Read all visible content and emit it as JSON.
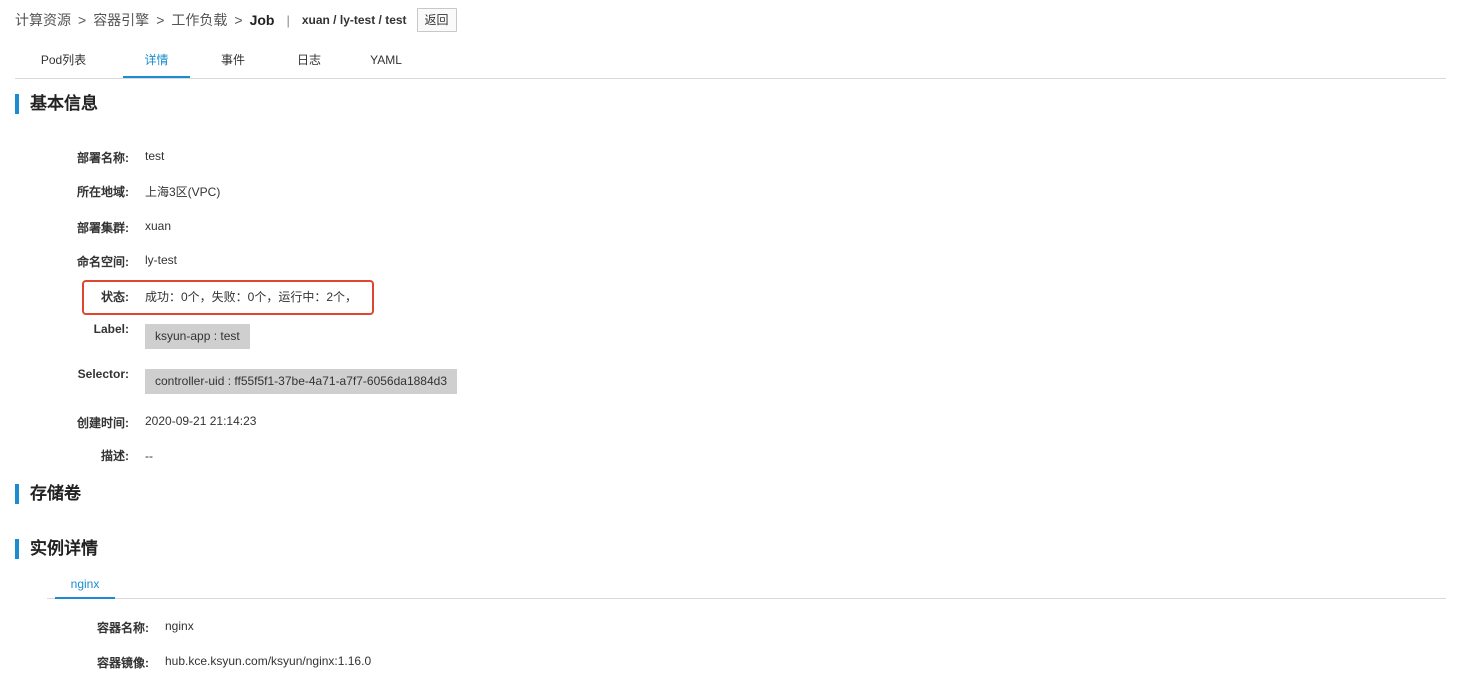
{
  "breadcrumb": {
    "items": [
      "计算资源",
      "容器引擎",
      "工作负载"
    ],
    "separator": ">",
    "current": "Job",
    "divider": "|",
    "path": "xuan / ly-test / test",
    "back_label": "返回"
  },
  "tabs": [
    {
      "label": "Pod列表",
      "active": false
    },
    {
      "label": "详情",
      "active": true
    },
    {
      "label": "事件",
      "active": false
    },
    {
      "label": "日志",
      "active": false
    },
    {
      "label": "YAML",
      "active": false
    }
  ],
  "sections": {
    "basic": "基本信息",
    "storage": "存储卷",
    "instance": "实例详情"
  },
  "basic_info": {
    "name_label": "部署名称:",
    "name": "test",
    "region_label": "所在地域:",
    "region": "上海3区(VPC)",
    "cluster_label": "部署集群:",
    "cluster": "xuan",
    "namespace_label": "命名空间:",
    "namespace": "ly-test",
    "status_label": "状态:",
    "status": "成功：0个，失败：0个，运行中：2个，",
    "label_label": "Label:",
    "label_tag": "ksyun-app : test",
    "selector_label": "Selector:",
    "selector_tag": "controller-uid : ff55f5f1-37be-4a71-a7f7-6056da1884d3",
    "created_label": "创建时间:",
    "created": "2020-09-21 21:14:23",
    "desc_label": "描述:",
    "desc": "--"
  },
  "instance": {
    "tab": "nginx",
    "container_name_label": "容器名称:",
    "container_name": "nginx",
    "image_label": "容器镜像:",
    "image": "hub.kce.ksyun.com/ksyun/nginx:1.16.0"
  },
  "colors": {
    "accent": "#1a8ccf",
    "highlight": "#e0462f",
    "tag_bg": "#cfcfcf"
  }
}
